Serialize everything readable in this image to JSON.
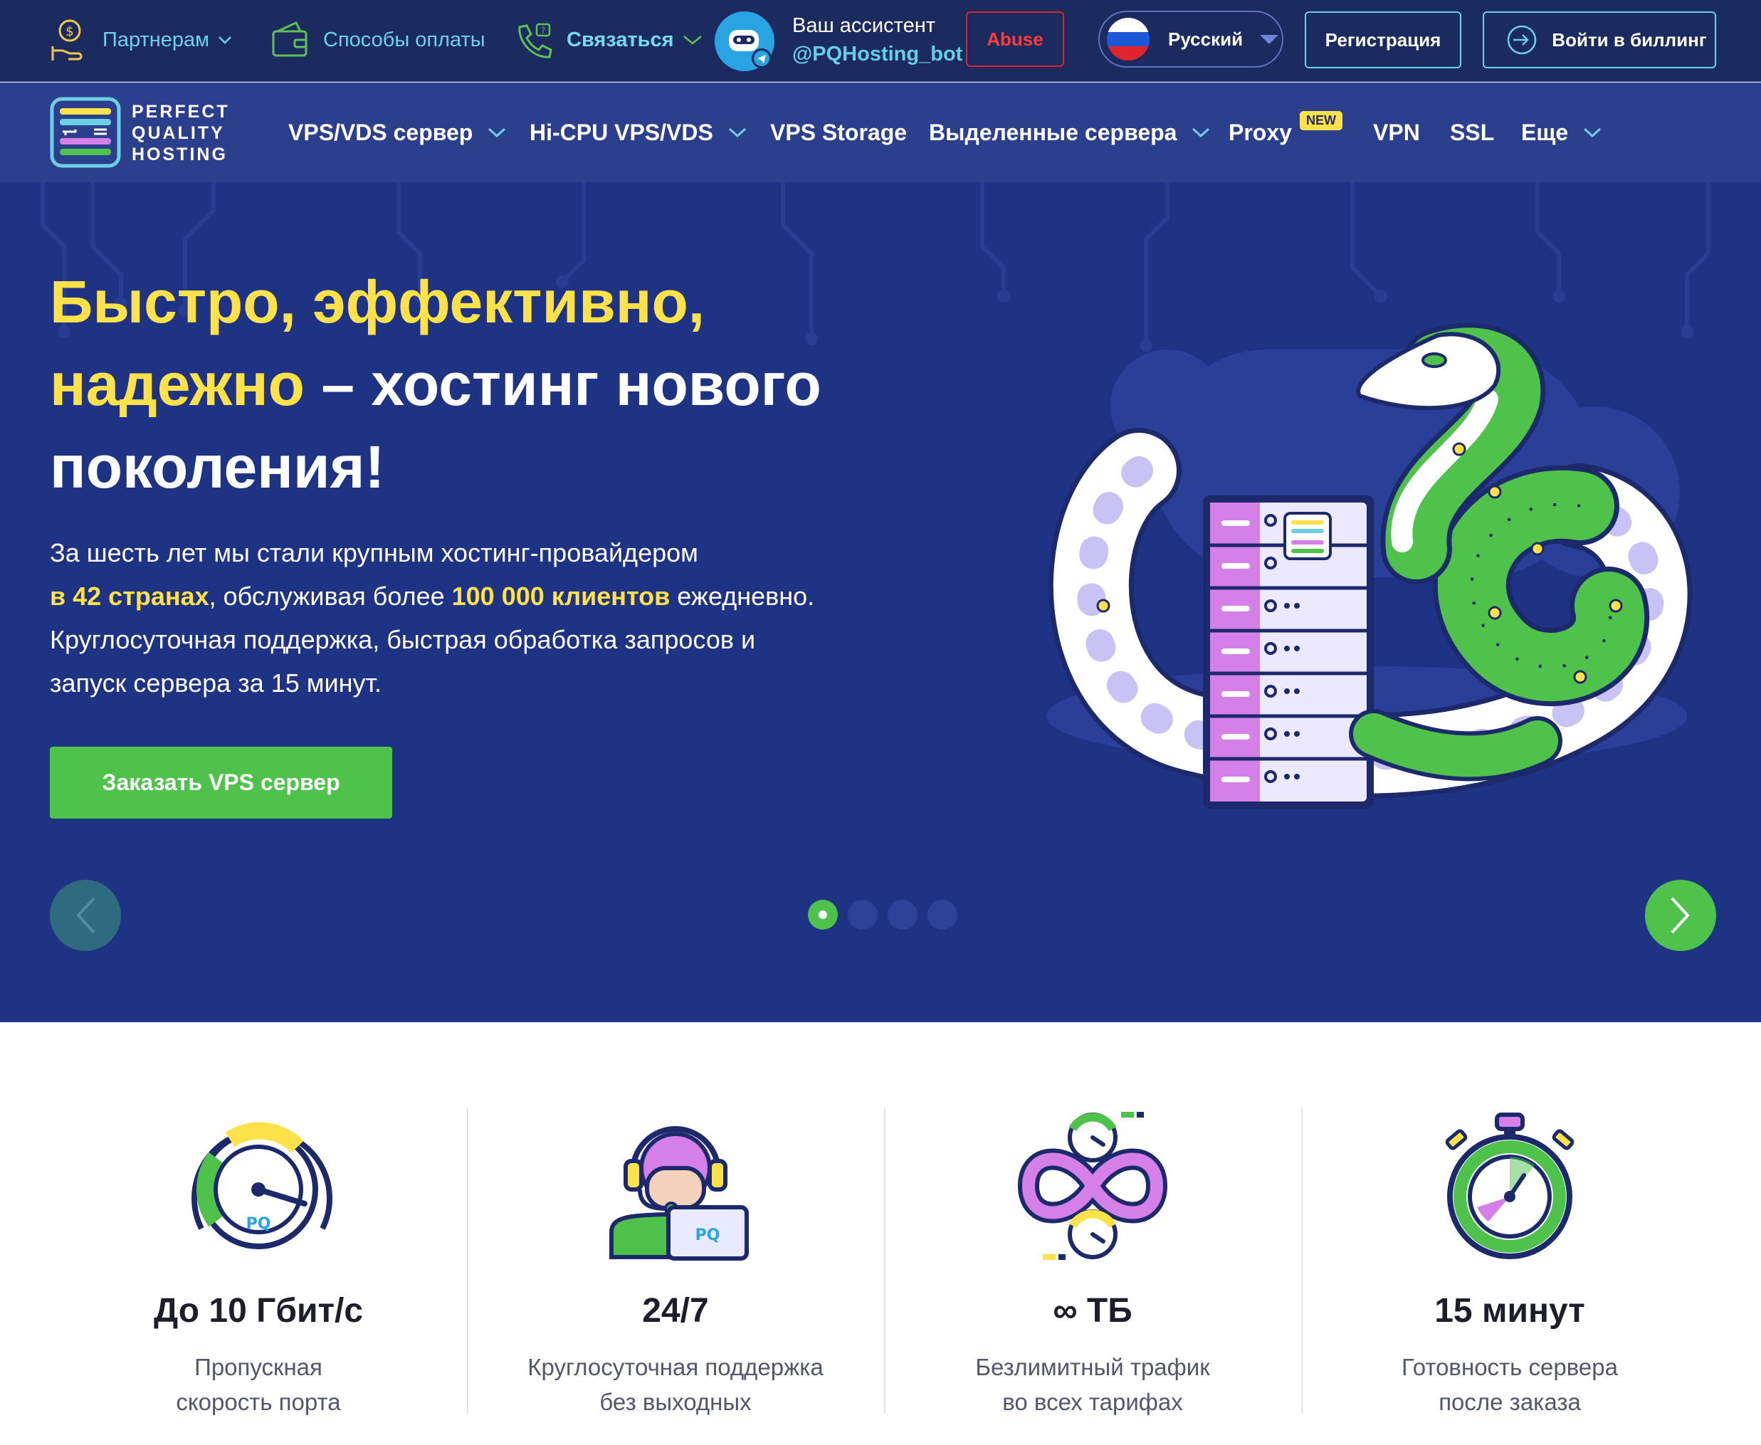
{
  "topbar": {
    "partners_label": "Партнерам",
    "payment_label": "Способы оплаты",
    "contact_label": "Связаться",
    "assistant_line1": "Ваш ассистент",
    "assistant_line2": "@PQHosting_bot",
    "abuse_label": "Abuse",
    "language_label": "Русский",
    "register_label": "Регистрация",
    "billing_label": "Войти в биллинг"
  },
  "logo": {
    "line1": "PERFECT",
    "line2": "QUALITY",
    "line3": "HOSTING",
    "mark": "PQ"
  },
  "nav": {
    "items": [
      {
        "label": "VPS/VDS сервер"
      },
      {
        "label": "Hi-CPU VPS/VDS"
      },
      {
        "label": "VPS Storage"
      },
      {
        "label": "Выделенные сервера"
      },
      {
        "label": "Proxy"
      },
      {
        "label": "VPN"
      },
      {
        "label": "SSL"
      },
      {
        "label": "Еще"
      }
    ],
    "new_badge": "NEW"
  },
  "hero": {
    "title_yellow_1": "Быстро, эффективно,",
    "title_yellow_2": "надежно",
    "title_white_2": " – хостинг нового",
    "title_white_3": "поколения!",
    "desc_1": "За шесть лет мы стали крупным хостинг-провайдером",
    "desc_2_bold": "в 42 странах",
    "desc_2_mid": ", обслуживая более ",
    "desc_2_bold2": "100 000 клиентов",
    "desc_2_end": " ежедневно.",
    "desc_3": "Круглосуточная поддержка, быстрая обработка запросов и",
    "desc_4": "запуск сервера за 15 минут.",
    "cta_label": "Заказать VPS сервер",
    "slides_total": 4,
    "slide_active": 1
  },
  "features": [
    {
      "icon": "speedometer-icon",
      "title": "До 10 Гбит/с",
      "desc_1": "Пропускная",
      "desc_2": "скорость порта"
    },
    {
      "icon": "support-agent-icon",
      "title": "24/7",
      "desc_1": "Круглосуточная поддержка",
      "desc_2": "без выходных"
    },
    {
      "icon": "infinity-icon",
      "title": "∞ ТБ",
      "desc_1": "Безлимитный трафик",
      "desc_2": "во всех тарифах"
    },
    {
      "icon": "stopwatch-icon",
      "title": "15 минут",
      "desc_1": "Готовность сервера",
      "desc_2": "после заказа"
    }
  ],
  "colors": {
    "topbar_bg": "#1b2a5f",
    "nav_bg": "#2b3f8c",
    "hero_bg": "#1f3384",
    "accent_yellow": "#ffe24a",
    "accent_green": "#4fc24c",
    "accent_cyan": "#6ed3e6",
    "abuse_red": "#d9262d"
  }
}
